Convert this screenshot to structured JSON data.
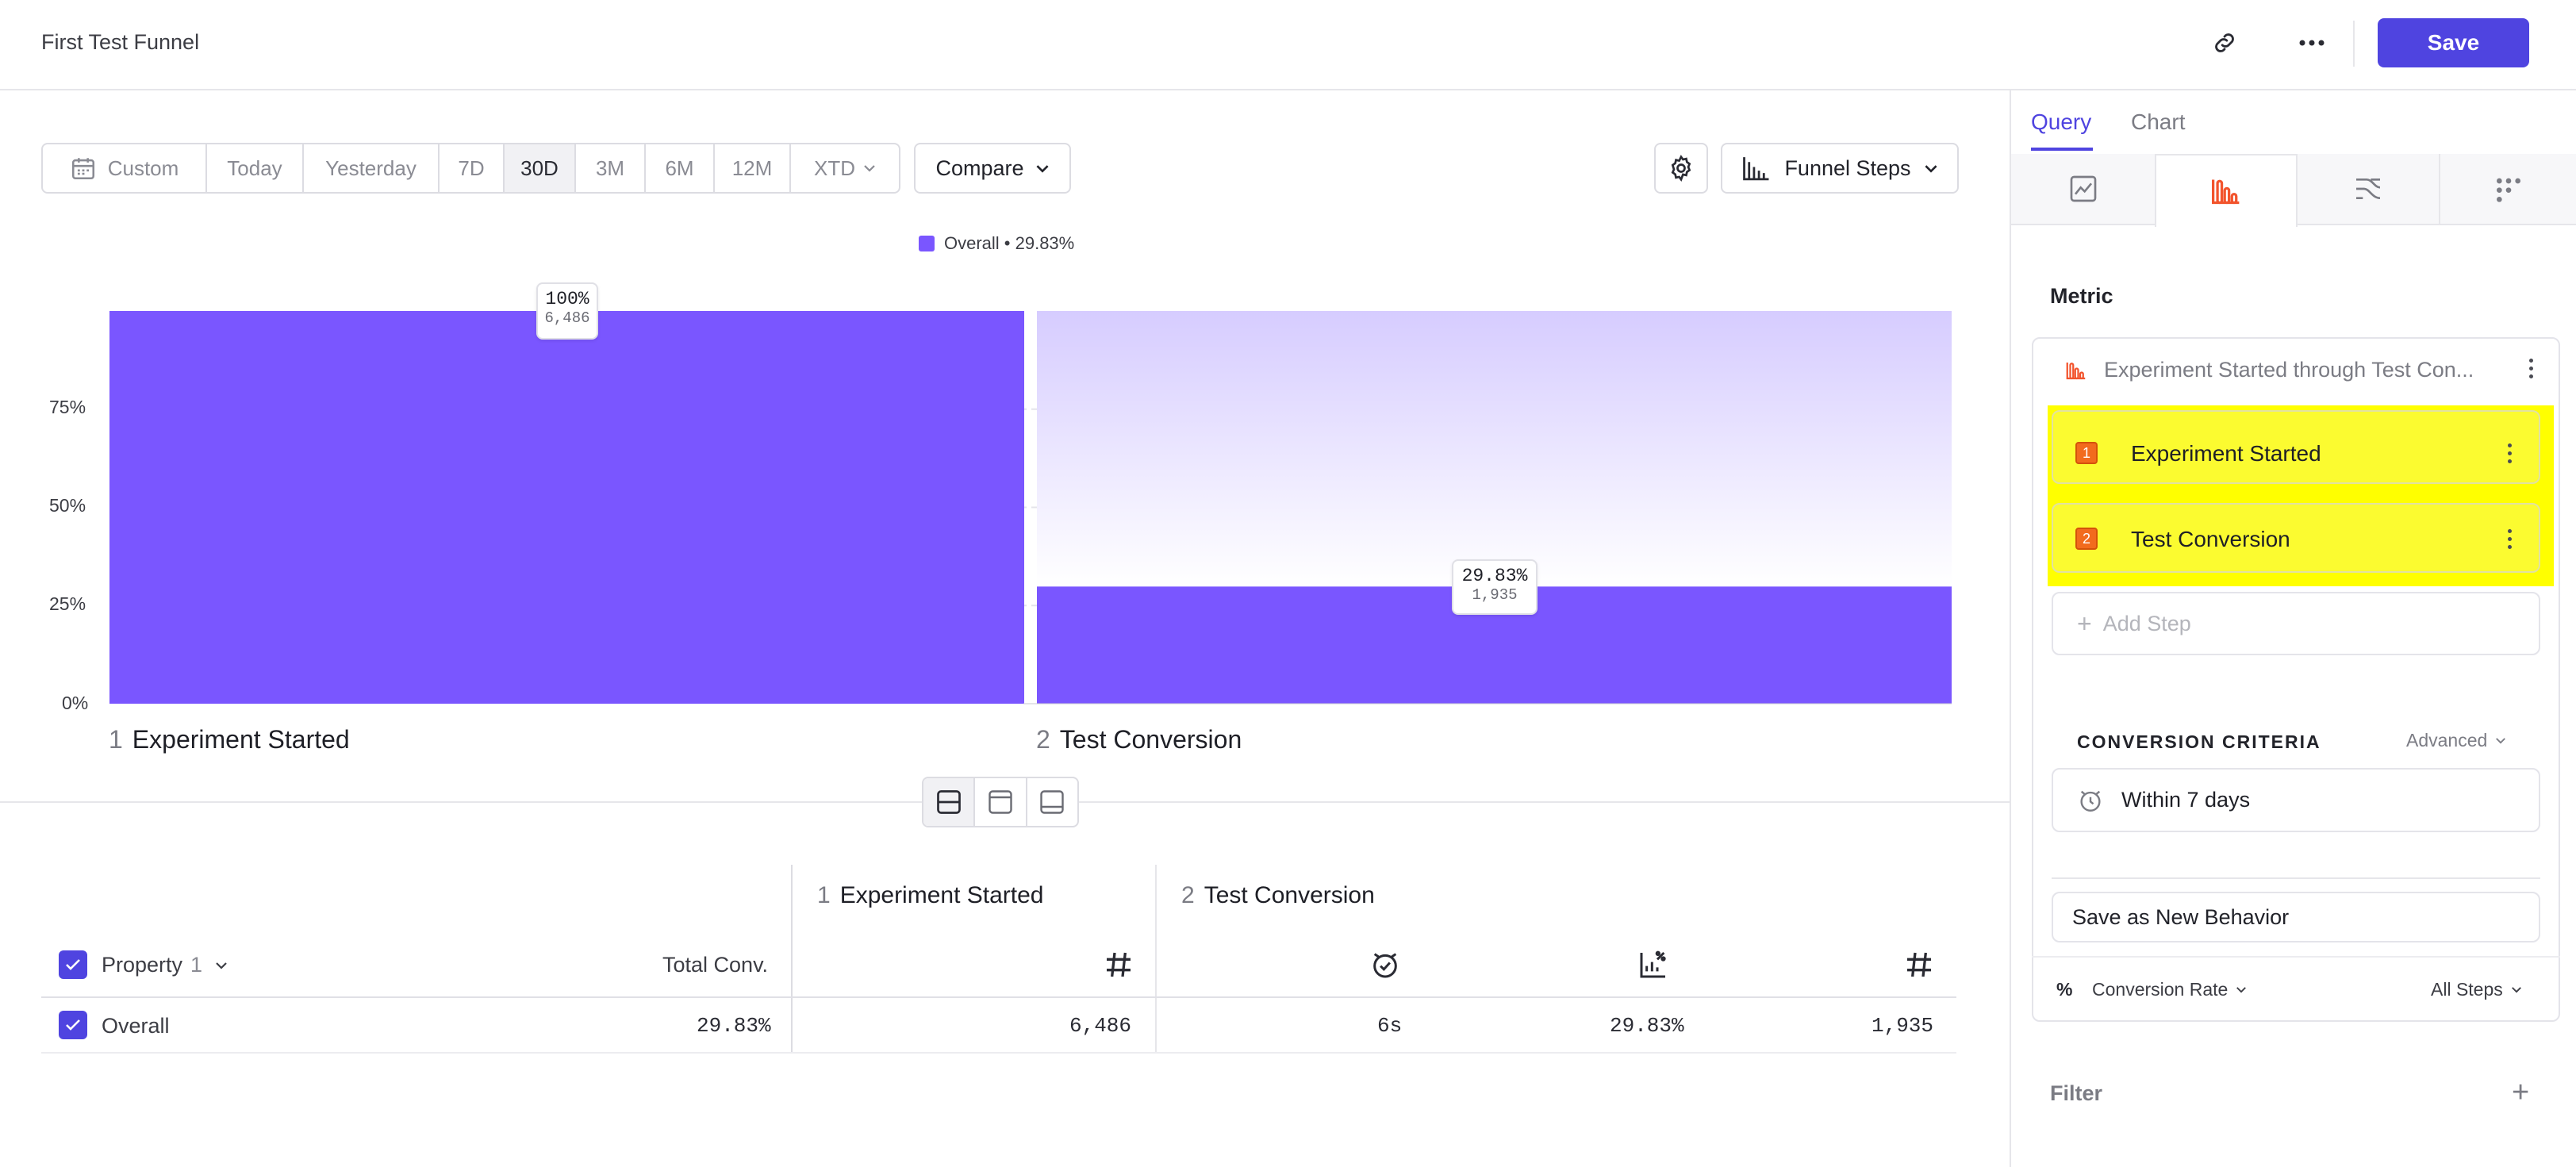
{
  "header": {
    "title": "First Test Funnel",
    "save_label": "Save"
  },
  "toolbar": {
    "date_ranges": [
      "Custom",
      "Today",
      "Yesterday",
      "7D",
      "30D",
      "3M",
      "6M",
      "12M",
      "XTD"
    ],
    "active_range": "30D",
    "compare_label": "Compare",
    "chart_type_label": "Funnel Steps"
  },
  "chart_data": {
    "type": "bar",
    "title": "",
    "legend": "Overall • 29.83%",
    "categories": [
      "Experiment Started",
      "Test Conversion"
    ],
    "category_numbers": [
      "1",
      "2"
    ],
    "values": [
      100,
      29.83
    ],
    "counts": [
      "6,486",
      "1,935"
    ],
    "value_labels": [
      "100%",
      "29.83%"
    ],
    "yticks": [
      "0%",
      "25%",
      "50%",
      "75%"
    ],
    "ylim": [
      0,
      100
    ],
    "color": "#7a56ff",
    "dropoff_color": "#d9d0ff"
  },
  "table": {
    "property_label": "Property",
    "property_count": "1",
    "total_conv_label": "Total Conv.",
    "step1_num": "1",
    "step1_label": "Experiment Started",
    "step2_num": "2",
    "step2_label": "Test Conversion",
    "row": {
      "label": "Overall",
      "total_conv": "29.83%",
      "step1_count": "6,486",
      "time": "6s",
      "rate": "29.83%",
      "step2_count": "1,935"
    }
  },
  "panel": {
    "tabs": [
      "Query",
      "Chart"
    ],
    "active_tab": "Query",
    "metric_label": "Metric",
    "metric_name": "Experiment Started through Test Con...",
    "steps": [
      {
        "num": "1",
        "label": "Experiment Started"
      },
      {
        "num": "2",
        "label": "Test Conversion"
      }
    ],
    "add_step_label": "Add Step",
    "conversion_criteria_label": "CONVERSION CRITERIA",
    "advanced_label": "Advanced",
    "within_label": "Within 7 days",
    "save_behavior_label": "Save as New Behavior",
    "percent_symbol": "%",
    "conversion_rate_label": "Conversion Rate",
    "all_steps_label": "All Steps",
    "filter_label": "Filter"
  },
  "colors": {
    "accent": "#4f44e0",
    "bar": "#7a56ff",
    "highlight": "#ffff00",
    "badge": "#f26b1d"
  }
}
